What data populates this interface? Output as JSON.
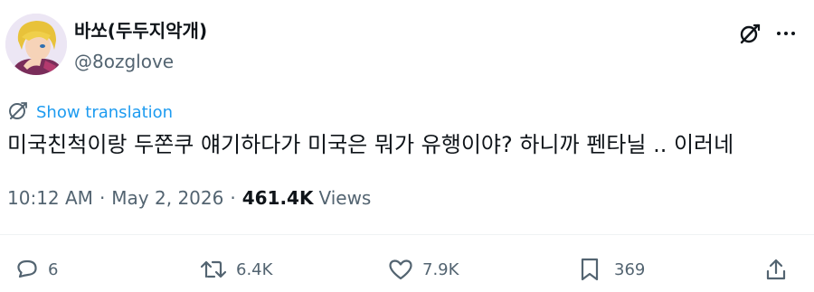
{
  "author": {
    "display_name": "바쏘(두두지악개)",
    "handle": "@8ozglove"
  },
  "header_icons": {
    "grok": "grok-icon",
    "more": "more-horizontal-icon"
  },
  "translation": {
    "icon": "globe-icon",
    "label": "Show translation"
  },
  "tweet": {
    "text": "미국친척이랑 두쫀쿠 얘기하다가 미국은 뭐가 유행이야? 하니까 펜타닐 .. 이러네"
  },
  "meta": {
    "time": "10:12 AM",
    "separator": "·",
    "date": "May 2, 2026",
    "views_count": "461.4K",
    "views_label": "Views"
  },
  "actions": {
    "replies": "6",
    "reposts": "6.4K",
    "likes": "7.9K",
    "bookmarks": "369"
  },
  "colors": {
    "text": "#0f1419",
    "secondary": "#536471",
    "accent": "#1d9bf0",
    "divider": "#eff3f4"
  }
}
